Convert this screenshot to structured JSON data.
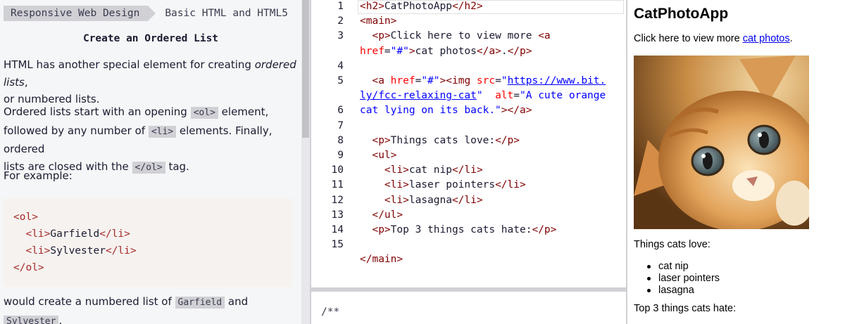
{
  "breadcrumbs": [
    "Responsive Web Design",
    "Basic HTML and HTML5"
  ],
  "challenge_title": "Create an Ordered List",
  "description": {
    "p1_a": "HTML has another special element for creating ",
    "p1_em": "ordered lists",
    "p1_b": ",",
    "p1_c": "or numbered lists.",
    "p2_a": "Ordered lists start with an opening ",
    "p2_code1": "<ol>",
    "p2_b": " element,",
    "p2_c": "followed by any number of ",
    "p2_code2": "<li>",
    "p2_d": " elements. Finally, ordered",
    "p2_e": "lists are closed with the ",
    "p2_code3": "</ol>",
    "p2_f": " tag.",
    "p3": "For example:",
    "p4_a": "would create a numbered list of ",
    "p4_code1": "Garfield",
    "p4_b": " and",
    "p4_code2": "Sylvester",
    "p4_c": "."
  },
  "example_code": {
    "ol_open": "<ol>",
    "li_open": "<li>",
    "li_close": "</li>",
    "item1": "Garfield",
    "item2": "Sylvester",
    "ol_close": "</ol>"
  },
  "editor": {
    "line_numbers": [
      "1",
      "2",
      "3",
      "",
      "4",
      "5",
      "",
      "6",
      "7",
      "8",
      "9",
      "10",
      "11",
      "12",
      "13",
      "14",
      "15"
    ],
    "lines": [
      [
        [
          "t",
          "<h2>"
        ],
        [
          "",
          "CatPhotoApp"
        ],
        [
          "t",
          "</h2>"
        ]
      ],
      [
        [
          "t",
          "<main>"
        ]
      ],
      [
        [
          "",
          "  "
        ],
        [
          "t",
          "<p>"
        ],
        [
          "",
          "Click here to view more "
        ],
        [
          "t",
          "<a"
        ]
      ],
      [
        [
          "a",
          "href"
        ],
        [
          "",
          "="
        ],
        [
          "v",
          "\"#\""
        ],
        [
          "t",
          ">"
        ],
        [
          "",
          "cat photos"
        ],
        [
          "t",
          "</a>"
        ],
        [
          "",
          "."
        ],
        [
          "t",
          "</p>"
        ]
      ],
      [],
      [
        [
          "",
          "  "
        ],
        [
          "t",
          "<a "
        ],
        [
          "a",
          "href"
        ],
        [
          "",
          "="
        ],
        [
          "v",
          "\"#\""
        ],
        [
          "t",
          "><img "
        ],
        [
          "a",
          "src"
        ],
        [
          "",
          "="
        ],
        [
          "v",
          "\""
        ],
        [
          "u",
          "https://www.bit."
        ]
      ],
      [
        [
          "u",
          "ly/fcc-relaxing-cat"
        ],
        [
          "v",
          "\""
        ],
        [
          "",
          "  "
        ],
        [
          "a",
          "alt"
        ],
        [
          "",
          "="
        ],
        [
          "v",
          "\"A cute orange"
        ]
      ],
      [
        [
          "v",
          "cat lying on its back.\""
        ],
        [
          "t",
          "></a>"
        ]
      ],
      [],
      [
        [
          "",
          "  "
        ],
        [
          "t",
          "<p>"
        ],
        [
          "",
          "Things cats love:"
        ],
        [
          "t",
          "</p>"
        ]
      ],
      [
        [
          "",
          "  "
        ],
        [
          "t",
          "<ul>"
        ]
      ],
      [
        [
          "",
          "    "
        ],
        [
          "t",
          "<li>"
        ],
        [
          "",
          "cat nip"
        ],
        [
          "t",
          "</li>"
        ]
      ],
      [
        [
          "",
          "    "
        ],
        [
          "t",
          "<li>"
        ],
        [
          "",
          "laser pointers"
        ],
        [
          "t",
          "</li>"
        ]
      ],
      [
        [
          "",
          "    "
        ],
        [
          "t",
          "<li>"
        ],
        [
          "",
          "lasagna"
        ],
        [
          "t",
          "</li>"
        ]
      ],
      [
        [
          "",
          "  "
        ],
        [
          "t",
          "</ul>"
        ]
      ],
      [
        [
          "",
          "  "
        ],
        [
          "t",
          "<p>"
        ],
        [
          "",
          "Top 3 things cats hate:"
        ],
        [
          "t",
          "</p>"
        ]
      ],
      [],
      [
        [
          "t",
          "</main>"
        ]
      ]
    ],
    "css_comment": "/**"
  },
  "preview": {
    "heading": "CatPhotoApp",
    "intro_text": "Click here to view more ",
    "link_text": "cat photos",
    "intro_end": ".",
    "image_alt": "A cute orange cat lying on its back.",
    "love_heading": "Things cats love:",
    "love_items": [
      "cat nip",
      "laser pointers",
      "lasagna"
    ],
    "hate_heading": "Top 3 things cats hate:"
  },
  "colors": {
    "tag": "#800000",
    "attribute": "#ff0000",
    "value": "#0000ff",
    "link": "#0000ee"
  }
}
